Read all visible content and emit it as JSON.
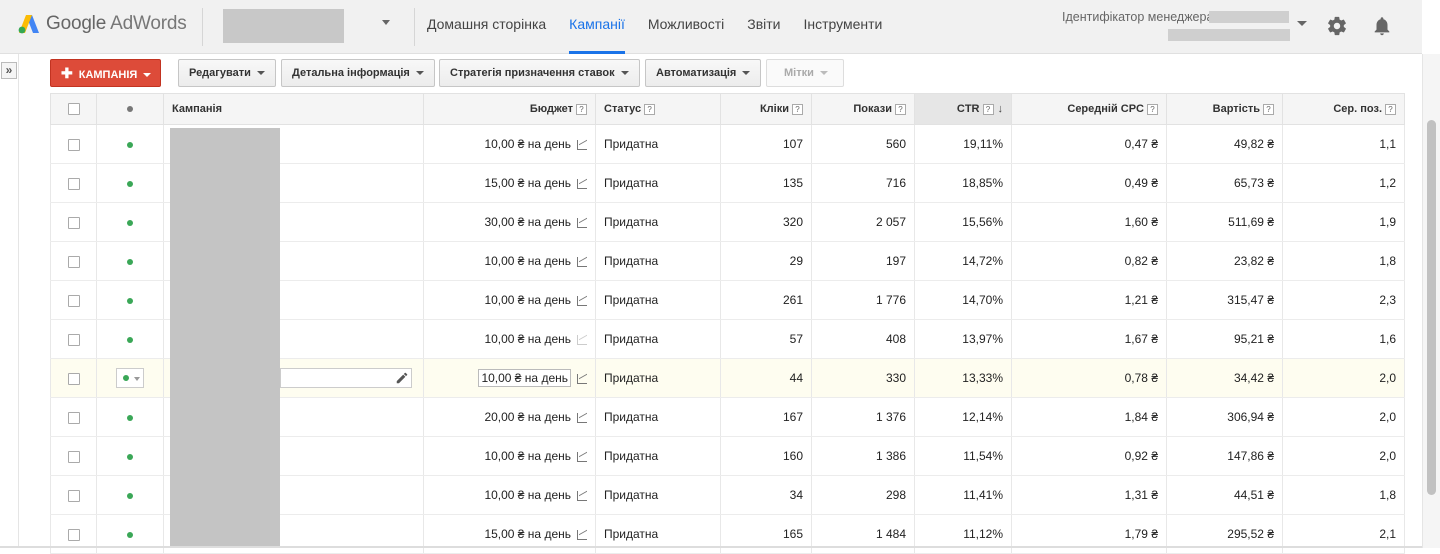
{
  "header": {
    "logo_google": "Google",
    "logo_product": "AdWords",
    "nav": [
      {
        "label": "Домашня сторінка",
        "active": false
      },
      {
        "label": "Кампанії",
        "active": true
      },
      {
        "label": "Можливості",
        "active": false
      },
      {
        "label": "Звіти",
        "active": false
      },
      {
        "label": "Інструменти",
        "active": false
      }
    ],
    "manager_id_label": "Ідентифікатор менеджера:",
    "accent_color": "#1a73e8"
  },
  "toolbar": {
    "campaign_button": "КАМПАНІЯ",
    "edit_button": "Редагувати",
    "details_button": "Детальна інформація",
    "bid_strategy_button": "Стратегія призначення ставок",
    "automation_button": "Автоматизація",
    "labels_button": "Мітки",
    "campaign_button_color": "#dd4b39"
  },
  "table": {
    "columns": {
      "campaign": "Кампанія",
      "budget": "Бюджет",
      "status": "Статус",
      "clicks": "Кліки",
      "impressions": "Покази",
      "ctr": "CTR",
      "avg_cpc": "Середній CPC",
      "cost": "Вартість",
      "avg_pos": "Сер. поз."
    },
    "help_glyph": "?",
    "sort_arrow": "↓",
    "rows": [
      {
        "budget": "10,00 ₴ на день",
        "status": "Придатна",
        "clicks": "107",
        "impressions": "560",
        "ctr": "19,11%",
        "avg_cpc": "0,47 ₴",
        "cost": "49,82 ₴",
        "avg_pos": "1,1"
      },
      {
        "budget": "15,00 ₴ на день",
        "status": "Придатна",
        "clicks": "135",
        "impressions": "716",
        "ctr": "18,85%",
        "avg_cpc": "0,49 ₴",
        "cost": "65,73 ₴",
        "avg_pos": "1,2"
      },
      {
        "budget": "30,00 ₴ на день",
        "status": "Придатна",
        "clicks": "320",
        "impressions": "2 057",
        "ctr": "15,56%",
        "avg_cpc": "1,60 ₴",
        "cost": "511,69 ₴",
        "avg_pos": "1,9"
      },
      {
        "budget": "10,00 ₴ на день",
        "status": "Придатна",
        "clicks": "29",
        "impressions": "197",
        "ctr": "14,72%",
        "avg_cpc": "0,82 ₴",
        "cost": "23,82 ₴",
        "avg_pos": "1,8"
      },
      {
        "budget": "10,00 ₴ на день",
        "status": "Придатна",
        "clicks": "261",
        "impressions": "1 776",
        "ctr": "14,70%",
        "avg_cpc": "1,21 ₴",
        "cost": "315,47 ₴",
        "avg_pos": "2,3"
      },
      {
        "budget": "10,00 ₴ на день",
        "status": "Придатна",
        "clicks": "57",
        "impressions": "408",
        "ctr": "13,97%",
        "avg_cpc": "1,67 ₴",
        "cost": "95,21 ₴",
        "avg_pos": "1,6"
      },
      {
        "budget": "10,00 ₴ на день",
        "status": "Придатна",
        "clicks": "44",
        "impressions": "330",
        "ctr": "13,33%",
        "avg_cpc": "0,78 ₴",
        "cost": "34,42 ₴",
        "avg_pos": "2,0"
      },
      {
        "budget": "20,00 ₴ на день",
        "status": "Придатна",
        "clicks": "167",
        "impressions": "1 376",
        "ctr": "12,14%",
        "avg_cpc": "1,84 ₴",
        "cost": "306,94 ₴",
        "avg_pos": "2,0"
      },
      {
        "budget": "10,00 ₴ на день",
        "status": "Придатна",
        "clicks": "160",
        "impressions": "1 386",
        "ctr": "11,54%",
        "avg_cpc": "0,92 ₴",
        "cost": "147,86 ₴",
        "avg_pos": "2,0"
      },
      {
        "budget": "10,00 ₴ на день",
        "status": "Придатна",
        "clicks": "34",
        "impressions": "298",
        "ctr": "11,41%",
        "avg_cpc": "1,31 ₴",
        "cost": "44,51 ₴",
        "avg_pos": "1,8"
      },
      {
        "budget": "15,00 ₴ на день",
        "status": "Придатна",
        "clicks": "165",
        "impressions": "1 484",
        "ctr": "11,12%",
        "avg_cpc": "1,79 ₴",
        "cost": "295,52 ₴",
        "avg_pos": "2,1"
      }
    ],
    "status_color": "#3aa757"
  },
  "sidebar": {
    "expand_glyph": "»"
  }
}
